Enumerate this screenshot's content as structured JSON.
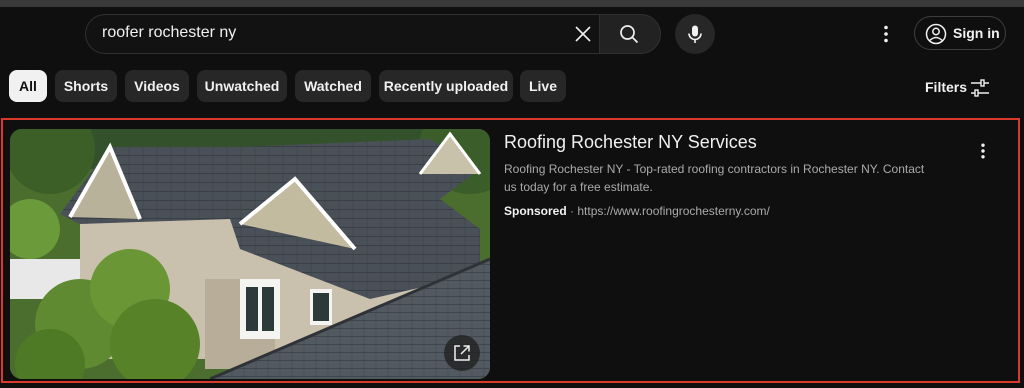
{
  "search": {
    "query": "roofer rochester ny"
  },
  "header": {
    "sign_in_label": "Sign in"
  },
  "chips": [
    "All",
    "Shorts",
    "Videos",
    "Unwatched",
    "Watched",
    "Recently uploaded",
    "Live"
  ],
  "active_chip": "All",
  "filters_label": "Filters",
  "ad": {
    "title": "Roofing Rochester NY Services",
    "description": "Roofing Rochester NY - Top-rated roofing contractors in Rochester NY. Contact us today for a free estimate.",
    "sponsored_label": "Sponsored",
    "separator": "·",
    "url": "https://www.roofingrochesterny.com/"
  },
  "icons": {
    "clear": "close-icon",
    "search": "search-icon",
    "mic": "mic-icon",
    "more": "more-vert-icon",
    "account": "account-circle-icon",
    "filters": "tune-icon",
    "open": "open-external-icon"
  },
  "colors": {
    "background": "#0f0f0f",
    "chip": "#272727",
    "chip_active": "#f1f1f1",
    "highlight_border": "#d93a2b"
  }
}
